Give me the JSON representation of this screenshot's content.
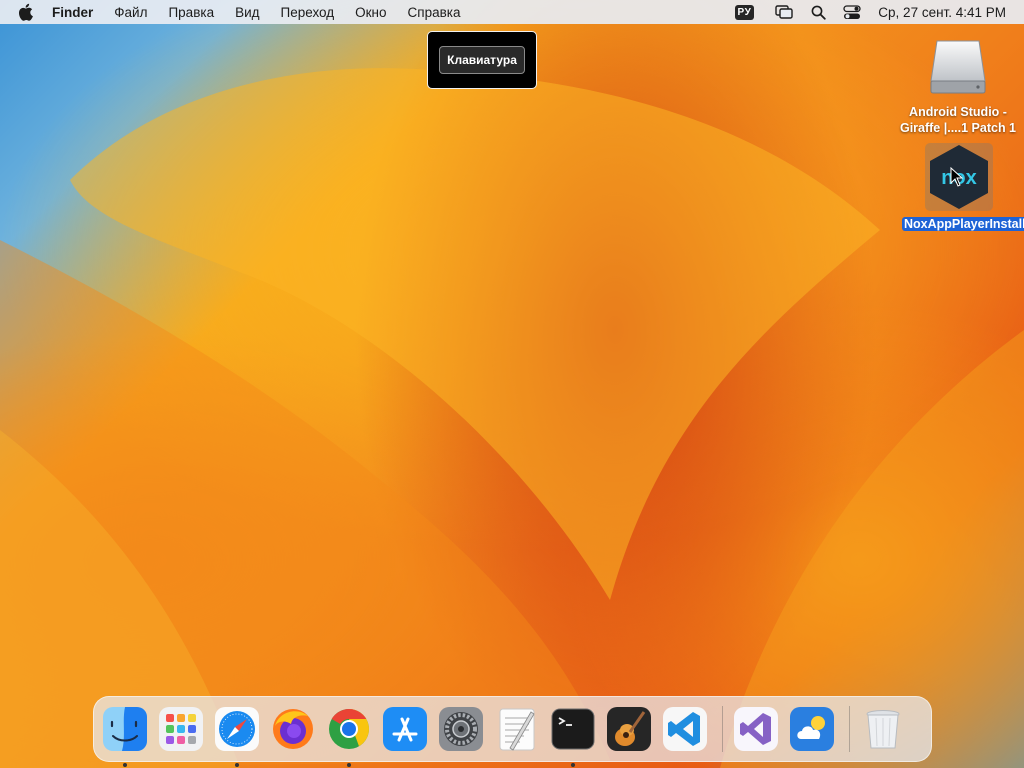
{
  "menubar": {
    "app_name": "Finder",
    "items": [
      "Файл",
      "Правка",
      "Вид",
      "Переход",
      "Окно",
      "Справка"
    ],
    "input_source": "РУ",
    "clock": "Ср, 27 сент.  4:41 PM",
    "icons": [
      "apple-icon",
      "screen-mirroring-icon",
      "spotlight-search-icon",
      "control-center-icon"
    ]
  },
  "hud": {
    "label": "Клавиатура"
  },
  "desktop": {
    "drive": {
      "label": "Android Studio - Giraffe |....1 Patch 1",
      "icon": "disk-image-icon"
    },
    "nox": {
      "label": "NoxAppPlayerInstaller",
      "icon": "nox-app-icon",
      "selected": true
    }
  },
  "dock": {
    "apps": [
      {
        "name": "Finder",
        "icon": "finder-icon",
        "running": true
      },
      {
        "name": "Launchpad",
        "icon": "launchpad-icon",
        "running": false
      },
      {
        "name": "Safari",
        "icon": "safari-icon",
        "running": true
      },
      {
        "name": "Firefox",
        "icon": "firefox-icon",
        "running": false
      },
      {
        "name": "Google Chrome",
        "icon": "chrome-icon",
        "running": true
      },
      {
        "name": "App Store",
        "icon": "app-store-icon",
        "running": false
      },
      {
        "name": "System Settings",
        "icon": "system-settings-icon",
        "running": false
      },
      {
        "name": "TextEdit",
        "icon": "textedit-icon",
        "running": false
      },
      {
        "name": "Terminal",
        "icon": "terminal-icon",
        "running": true
      },
      {
        "name": "GarageBand",
        "icon": "garageband-icon",
        "running": false
      },
      {
        "name": "Visual Studio Code",
        "icon": "vscode-icon",
        "running": false
      },
      {
        "name": "Visual Studio",
        "icon": "visual-studio-icon",
        "running": false
      },
      {
        "name": "Weather",
        "icon": "weather-icon",
        "running": false
      },
      {
        "name": "Trash",
        "icon": "trash-icon",
        "running": false
      }
    ]
  },
  "colors": {
    "wallpaper_orange": "#f6a71d",
    "wallpaper_red": "#d23a12",
    "wallpaper_blue": "#3b93d6",
    "selection_blue": "#1e63d6"
  }
}
